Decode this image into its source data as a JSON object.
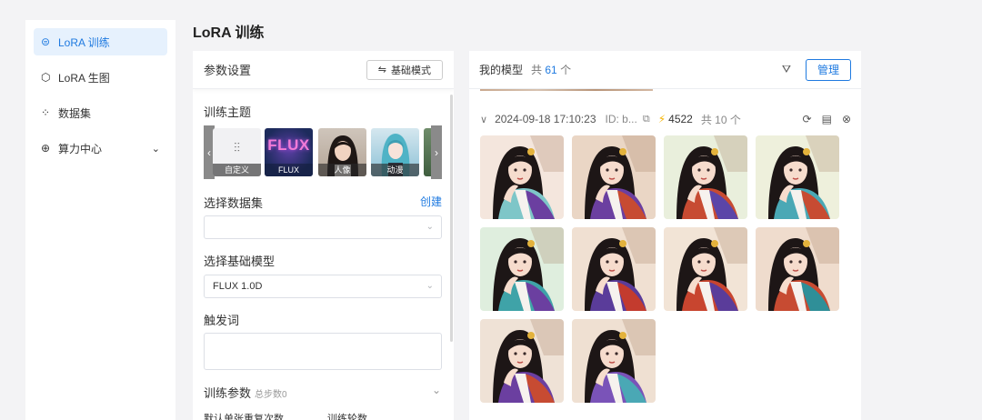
{
  "sidebar": {
    "items": [
      {
        "label": "LoRA 训练",
        "icon": "lora-train-icon",
        "active": true
      },
      {
        "label": "LoRA 生图",
        "icon": "lora-generate-icon",
        "active": false
      },
      {
        "label": "数据集",
        "icon": "dataset-icon",
        "active": false
      },
      {
        "label": "算力中心",
        "icon": "compute-icon",
        "active": false,
        "expandable": true
      }
    ]
  },
  "page": {
    "title": "LoRA 训练"
  },
  "params": {
    "header": "参数设置",
    "mode_button": "基础模式",
    "theme_label": "训练主题",
    "themes": [
      "自定义",
      "FLUX",
      "人像",
      "动漫"
    ],
    "flux_logo": "FLUX",
    "dataset_label": "选择数据集",
    "create_link": "创建",
    "dataset_value": "",
    "base_model_label": "选择基础模型",
    "base_model_value": "FLUX 1.0D",
    "trigger_label": "触发词",
    "trigger_value": "",
    "train_params_label": "训练参数",
    "train_params_sub": "总步数0",
    "repeat_label": "默认单张重复次数",
    "epoch_label": "训练轮数"
  },
  "models": {
    "header": "我的模型",
    "total_prefix": "共",
    "total_count": "61",
    "total_suffix": "个",
    "manage_button": "管理",
    "group": {
      "datetime": "2024-09-18 17:10:23",
      "id": "ID: b...",
      "points": "4522",
      "count": "共 10 个"
    },
    "images": 10
  },
  "colors": {
    "accent": "#1f7ae0",
    "active_bg": "#e6f1fd",
    "bolt": "#f5b300"
  }
}
